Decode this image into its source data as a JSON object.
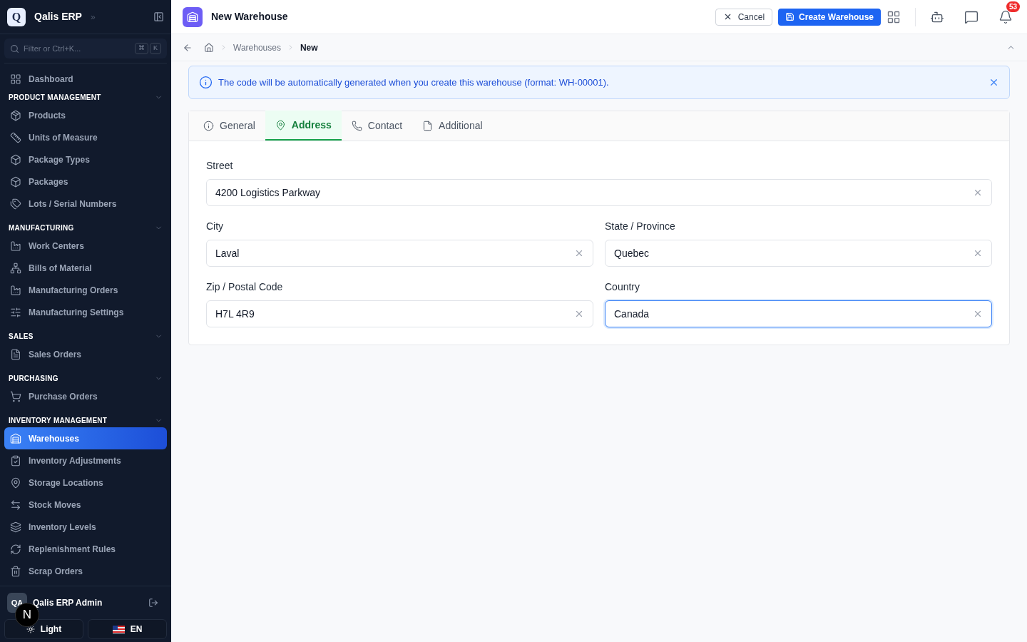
{
  "brand": {
    "logo": "Q",
    "name": "Qalis ERP",
    "expand": "»"
  },
  "filter": {
    "placeholder": "Filter or Ctrl+K...",
    "keys": [
      "⌘",
      "K"
    ]
  },
  "nav_top": {
    "label": "Dashboard",
    "selected": false
  },
  "sections": [
    {
      "title": "PRODUCT MANAGEMENT",
      "expanded": true,
      "items": [
        {
          "label": "Products",
          "selected": false
        },
        {
          "label": "Units of Measure",
          "selected": false
        },
        {
          "label": "Package Types",
          "selected": false
        },
        {
          "label": "Packages",
          "selected": false
        },
        {
          "label": "Lots / Serial Numbers",
          "selected": false
        }
      ]
    },
    {
      "title": "MANUFACTURING",
      "expanded": true,
      "items": [
        {
          "label": "Work Centers",
          "selected": false
        },
        {
          "label": "Bills of Material",
          "selected": false
        },
        {
          "label": "Manufacturing Orders",
          "selected": false
        },
        {
          "label": "Manufacturing Settings",
          "selected": false
        }
      ]
    },
    {
      "title": "SALES",
      "expanded": true,
      "items": [
        {
          "label": "Sales Orders",
          "selected": false
        }
      ]
    },
    {
      "title": "PURCHASING",
      "expanded": true,
      "items": [
        {
          "label": "Purchase Orders",
          "selected": false
        }
      ]
    },
    {
      "title": "INVENTORY MANAGEMENT",
      "expanded": true,
      "items": [
        {
          "label": "Warehouses",
          "selected": true
        },
        {
          "label": "Inventory Adjustments",
          "selected": false
        },
        {
          "label": "Storage Locations",
          "selected": false
        },
        {
          "label": "Stock Moves",
          "selected": false
        },
        {
          "label": "Inventory Levels",
          "selected": false
        },
        {
          "label": "Replenishment Rules",
          "selected": false
        },
        {
          "label": "Scrap Orders",
          "selected": false
        }
      ]
    }
  ],
  "user": {
    "initials": "QA",
    "name": "Qalis ERP Admin"
  },
  "dev_indicator": "N",
  "theme_button": "Light",
  "language_button": "EN",
  "header": {
    "title": "New Warehouse",
    "cancel": "Cancel",
    "create": "Create Warehouse",
    "notification_count": "53"
  },
  "breadcrumb": [
    "Warehouses",
    "New"
  ],
  "info_banner": "The code will be automatically generated when you create this warehouse (format: WH-00001).",
  "tabs": [
    {
      "label": "General",
      "selected": false
    },
    {
      "label": "Address",
      "selected": true
    },
    {
      "label": "Contact",
      "selected": false
    },
    {
      "label": "Additional",
      "selected": false
    }
  ],
  "fields": [
    {
      "label": "Street",
      "value": "4200 Logistics Parkway",
      "focused": false
    },
    {
      "label": "City",
      "value": "Laval",
      "focused": false
    },
    {
      "label": "State / Province",
      "value": "Quebec",
      "focused": false
    },
    {
      "label": "Zip / Postal Code",
      "value": "H7L 4R9",
      "focused": false
    },
    {
      "label": "Country",
      "value": "Canada",
      "focused": true
    }
  ]
}
